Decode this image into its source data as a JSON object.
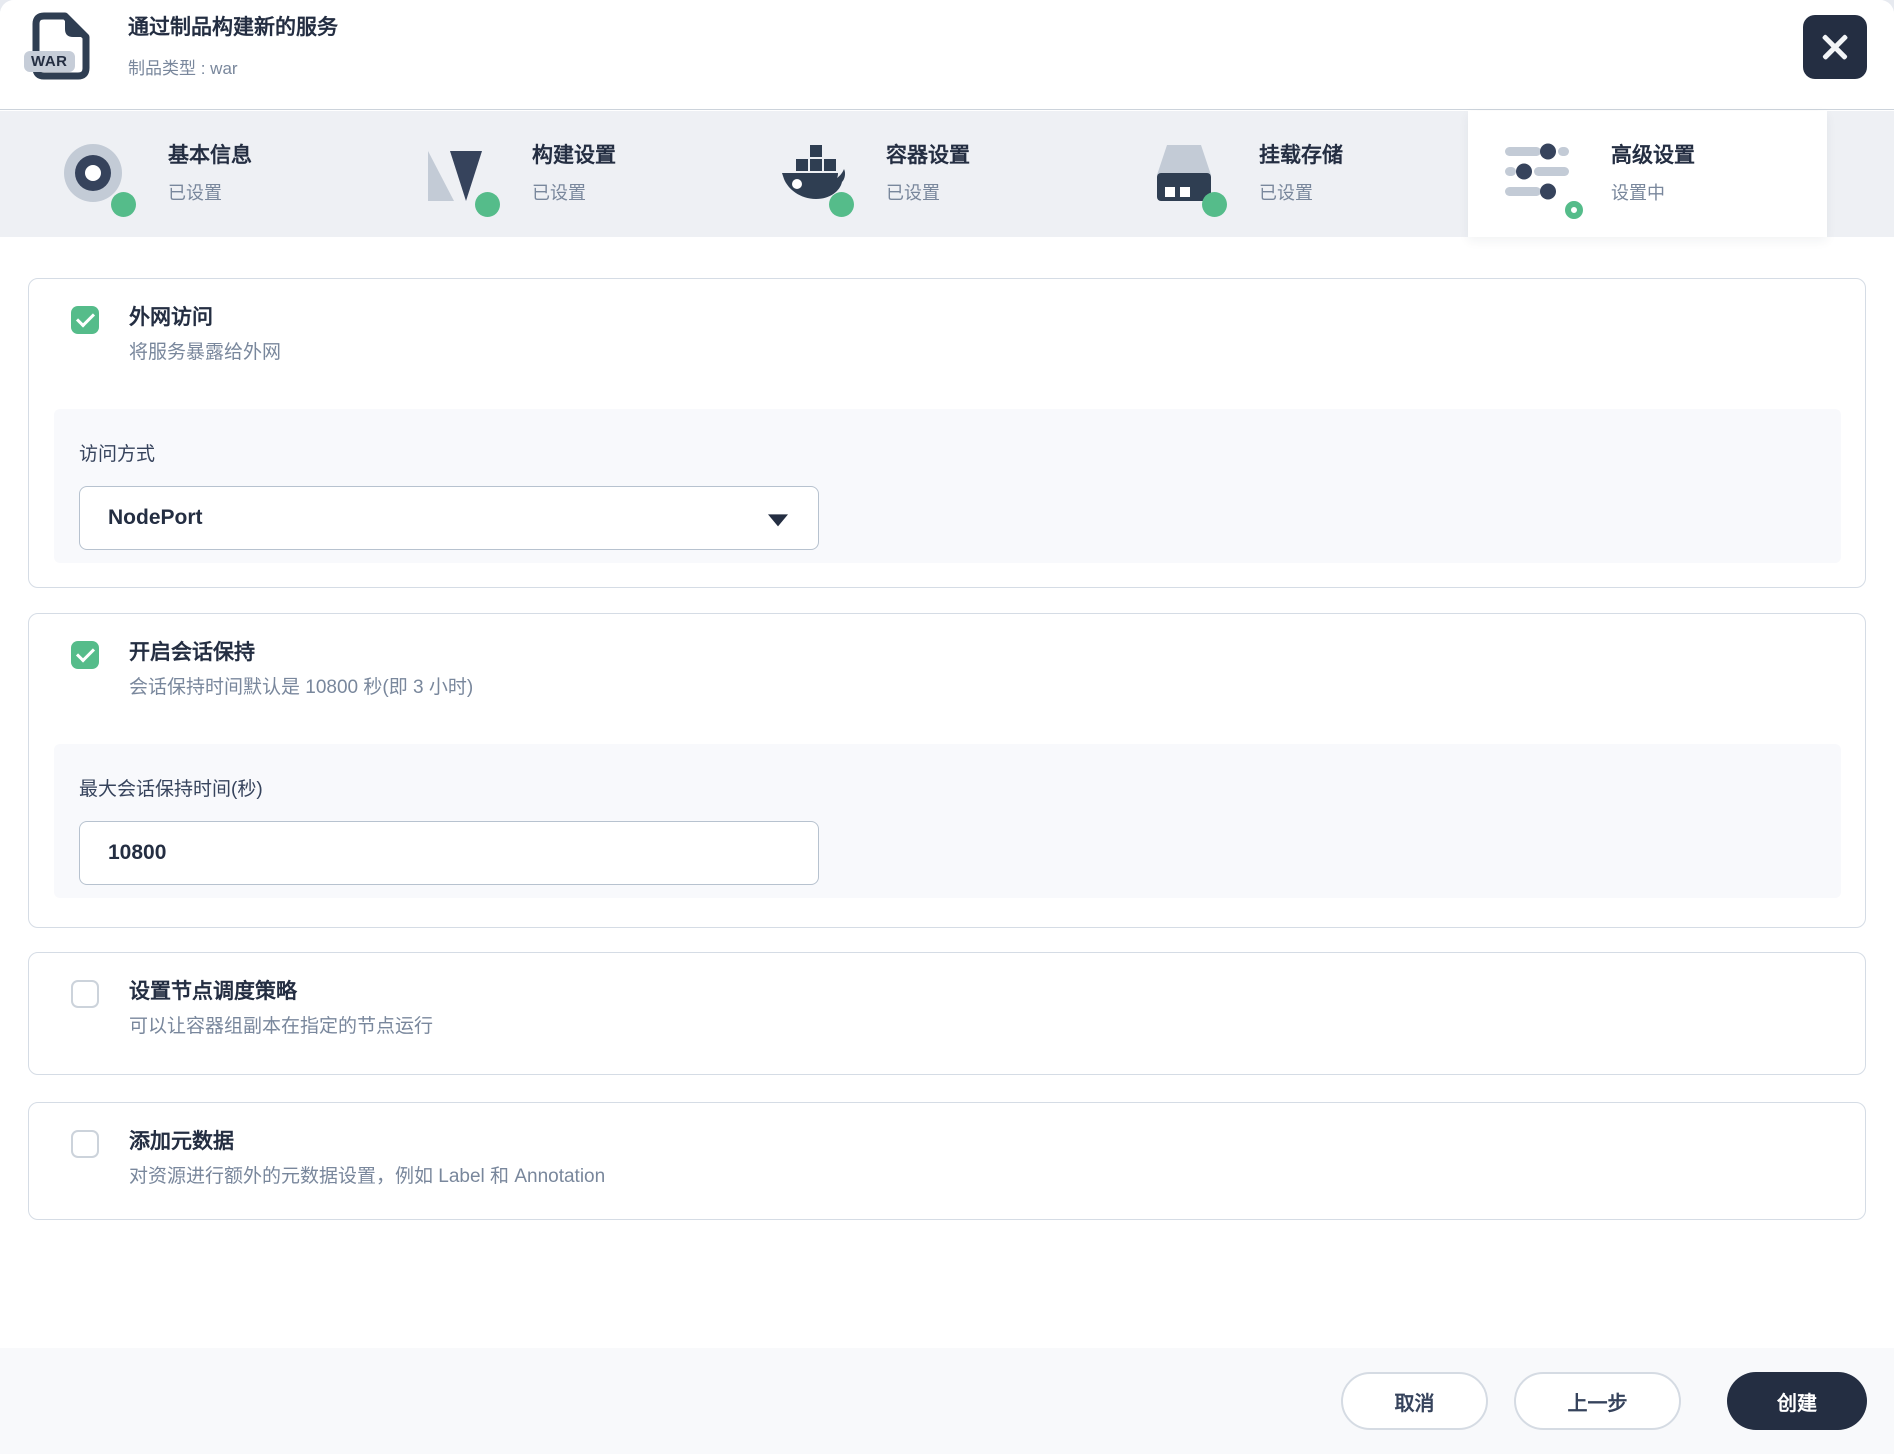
{
  "header": {
    "title": "通过制品构建新的服务",
    "subtitle": "制品类型 : war",
    "badge": "WAR"
  },
  "steps": [
    {
      "label": "基本信息",
      "status": "已设置",
      "icon": "basic-info-icon",
      "state": "done"
    },
    {
      "label": "构建设置",
      "status": "已设置",
      "icon": "build-settings-icon",
      "state": "done"
    },
    {
      "label": "容器设置",
      "status": "已设置",
      "icon": "container-settings-icon",
      "state": "done"
    },
    {
      "label": "挂载存储",
      "status": "已设置",
      "icon": "mount-storage-icon",
      "state": "done"
    },
    {
      "label": "高级设置",
      "status": "设置中",
      "icon": "advanced-settings-icon",
      "state": "active"
    }
  ],
  "sections": [
    {
      "checked": true,
      "title": "外网访问",
      "desc": "将服务暴露给外网",
      "field": {
        "label": "访问方式",
        "type": "select",
        "value": "NodePort"
      }
    },
    {
      "checked": true,
      "title": "开启会话保持",
      "desc": "会话保持时间默认是 10800 秒(即 3 小时)",
      "field": {
        "label": "最大会话保持时间(秒)",
        "type": "input",
        "value": "10800"
      }
    },
    {
      "checked": false,
      "title": "设置节点调度策略",
      "desc": "可以让容器组副本在指定的节点运行"
    },
    {
      "checked": false,
      "title": "添加元数据",
      "desc": "对资源进行额外的元数据设置，例如 Label 和 Annotation"
    }
  ],
  "footer": {
    "cancel": "取消",
    "previous": "上一步",
    "create": "创建"
  },
  "colors": {
    "accent_green": "#55bc8a",
    "dark_navy": "#242e42",
    "muted_text": "#79879c",
    "tabbar_bg": "#eef0f4",
    "footer_bg": "#f8f9fb",
    "card_border": "#d5dce5"
  }
}
